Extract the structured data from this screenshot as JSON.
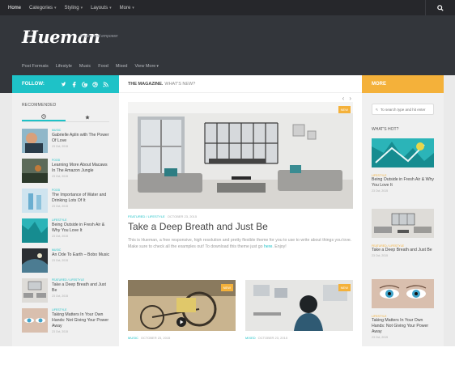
{
  "topnav": {
    "items": [
      {
        "label": "Home",
        "active": true,
        "caret": false
      },
      {
        "label": "Categories",
        "active": false,
        "caret": true
      },
      {
        "label": "Styling",
        "active": false,
        "caret": true
      },
      {
        "label": "Layouts",
        "active": false,
        "caret": true
      },
      {
        "label": "More",
        "active": false,
        "caret": true
      }
    ],
    "search_icon": "search-icon"
  },
  "header": {
    "logo": "Hueman",
    "tagline": "Inspire and empower",
    "subnav": [
      "Post Formats",
      "Lifestyle",
      "Music",
      "Food",
      "Mixed",
      "View More"
    ]
  },
  "left": {
    "follow_label": "FOLLOW:",
    "social_icons": [
      "twitter-icon",
      "facebook-icon",
      "google-icon",
      "dribbble-icon",
      "rss-icon"
    ],
    "recommended_label": "RECOMMENDED",
    "tabs": [
      "clock-icon",
      "star-icon"
    ],
    "items": [
      {
        "cat": "Music",
        "title": "Gabrielle Aplin with The Power Of Love",
        "date": "23 Oct, 2015"
      },
      {
        "cat": "Food",
        "title": "Learning More About Macaws In The Amazon Jungle",
        "date": "23 Oct, 2015"
      },
      {
        "cat": "Food",
        "title": "The Importance of Water and Drinking Lots Of It",
        "date": "23 Oct, 2015"
      },
      {
        "cat": "Lifestyle",
        "title": "Being Outside in Fresh Air & Why You Love It",
        "date": "23 Oct, 2015"
      },
      {
        "cat": "Music",
        "title": "An Ode To Earth – Bobo Music",
        "date": "23 Oct, 2015"
      },
      {
        "cat": "Featured / Lifestyle",
        "title": "Take a Deep Breath and Just Be",
        "date": "23 Oct, 2015"
      },
      {
        "cat": "Lifestyle",
        "title": "Taking Matters In Your Own Hands: Not Giving Your Power Away",
        "date": "23 Oct, 2015"
      }
    ]
  },
  "main": {
    "section_bold": "THE MAGAZINE.",
    "section_light": "WHAT'S NEW?",
    "featured": {
      "badge": "NEW",
      "cat": "FEATURED / LIFESTYLE",
      "date": "OCTOBER 23, 2015",
      "title": "Take a Deep Breath and Just Be",
      "excerpt": "This is Hueman, a free responsive, high resolution and pretty flexible theme for you to use to write about things you love. Make sure to check all the examples out! To download this theme just go",
      "link": "here",
      "excerpt_end": ". Enjoy!"
    },
    "grid": [
      {
        "cat": "MUSIC",
        "date": "OCTOBER 23, 2015",
        "badge": "NEW"
      },
      {
        "cat": "MIXED",
        "date": "OCTOBER 23, 2015",
        "badge": "NEW"
      }
    ]
  },
  "right": {
    "more_label": "MORE",
    "search_placeholder": "To search type and hit enter",
    "whats_hot_label": "WHAT'S HOT?",
    "items": [
      {
        "cat": "Lifestyle",
        "title": "Being Outside in Fresh Air & Why You Love It",
        "date": "23 Oct, 2015"
      },
      {
        "cat": "Featured / Lifestyle",
        "title": "Take a Deep Breath and Just Be",
        "date": "23 Oct, 2015"
      },
      {
        "cat": "Lifestyle",
        "title": "Taking Matters In Your Own Hands: Not Giving Your Power Away",
        "date": "23 Oct, 2015"
      }
    ]
  },
  "colors": {
    "accent": "#1ec2c7",
    "orange": "#f4b13a",
    "header": "#33363b",
    "topbar": "#26272b"
  }
}
